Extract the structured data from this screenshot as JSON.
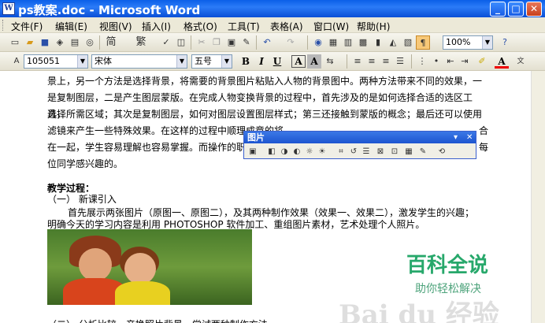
{
  "window": {
    "title": "ps教案.doc - Microsoft Word",
    "app_icon_glyph": "W",
    "controls": {
      "minimize": "_",
      "maximize": "□",
      "close": "✕"
    }
  },
  "menu": {
    "items": [
      "文件(F)",
      "编辑(E)",
      "视图(V)",
      "插入(I)",
      "格式(O)",
      "工具(T)",
      "表格(A)",
      "窗口(W)",
      "帮助(H)"
    ]
  },
  "toolbar": {
    "zoom": "100%",
    "simp_label": "简",
    "trad_label": "繁"
  },
  "format_bar": {
    "style": "105051",
    "font": "宋体",
    "size": "五号",
    "bold": "B",
    "italic": "I",
    "underline": "U",
    "char_border": "A",
    "char_shade": "A",
    "font_color": "A"
  },
  "picture_toolbar": {
    "title": "图片",
    "dropdown": "▾",
    "close": "✕"
  },
  "document": {
    "lines": [
      "景上，另一个方法是选择背景，将需要的背景图片粘贴入人物的背景图中。两种方法带来不同的效果，一",
      "是复制图层，二是产生图层蒙版。在完成人物变换背景的过程中，首先涉及的是如何选择合适的选区工具，",
      "选择所需区域；其次是复制图层，如何对图层设置图层样式；第三还接触到蒙版的概念；最后还可以使用",
      "滤镜来产生一些特殊效果。在这样的过程中顺理成章的将",
      "在一起，学生容易理解也容易掌握。而操作的职",
      "位同学感兴趣的。"
    ],
    "right_fragment_1": "合",
    "right_fragment_2": "每",
    "heading": "教学过程：",
    "section1": "（一）  新课引入",
    "intro_line1": "首先展示两张图片（原图一、原图二），及其两种制作效果（效果一、效果二），激发学生的兴趣；",
    "intro_line2": "明确今天的学习内容是利用 PHOTOSHOP 软件加工、重组图片素材，艺术处理个人照片。",
    "section2": "（二）  分析比较，产换照片背景，尝试两种制作方法"
  },
  "watermark": {
    "main": "百科全说",
    "sub": "助你轻松解决",
    "baidu": "Bai du 经验"
  }
}
